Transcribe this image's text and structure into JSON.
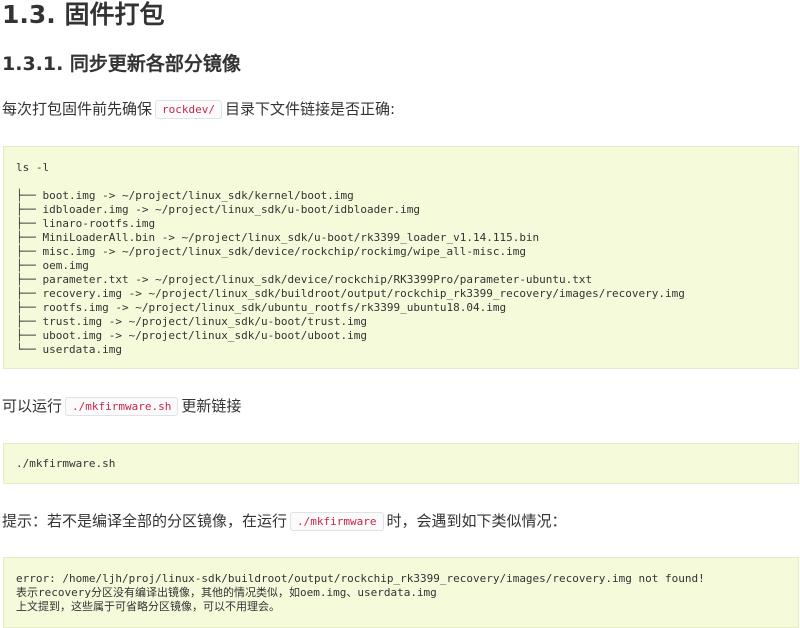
{
  "heading": "1.3. 固件打包",
  "subheading": "1.3.1. 同步更新各部分镜像",
  "intro": {
    "before": "每次打包固件前先确保",
    "code": "rockdev/",
    "after": "目录下文件链接是否正确:"
  },
  "listing": [
    "ls -l",
    "",
    "├── boot.img -> ~/project/linux_sdk/kernel/boot.img",
    "├── idbloader.img -> ~/project/linux_sdk/u-boot/idbloader.img",
    "├── linaro-rootfs.img",
    "├── MiniLoaderAll.bin -> ~/project/linux_sdk/u-boot/rk3399_loader_v1.14.115.bin",
    "├── misc.img -> ~/project/linux_sdk/device/rockchip/rockimg/wipe_all-misc.img",
    "├── oem.img",
    "├── parameter.txt -> ~/project/linux_sdk/device/rockchip/RK3399Pro/parameter-ubuntu.txt",
    "├── recovery.img -> ~/project/linux_sdk/buildroot/output/rockchip_rk3399_recovery/images/recovery.img",
    "├── rootfs.img -> ~/project/linux_sdk/ubuntu_rootfs/rk3399_ubuntu18.04.img",
    "├── trust.img -> ~/project/linux_sdk/u-boot/trust.img",
    "├── uboot.img -> ~/project/linux_sdk/u-boot/uboot.img",
    "└── userdata.img"
  ],
  "run_note": {
    "before": "可以运行",
    "code": "./mkfirmware.sh",
    "after": "更新链接"
  },
  "run_command": "./mkfirmware.sh",
  "tip": {
    "before": "提示：若不是编译全部的分区镜像，在运行",
    "code": "./mkfirmware",
    "after": "时，会遇到如下类似情况："
  },
  "error_output": [
    "error: /home/ljh/proj/linux-sdk/buildroot/output/rockchip_rk3399_recovery/images/recovery.img not found!",
    "表示recovery分区没有编译出镜像，其他的情况类似，如oem.img、userdata.img",
    "上文提到，这些属于可省略分区镜像，可以不用理会。"
  ]
}
